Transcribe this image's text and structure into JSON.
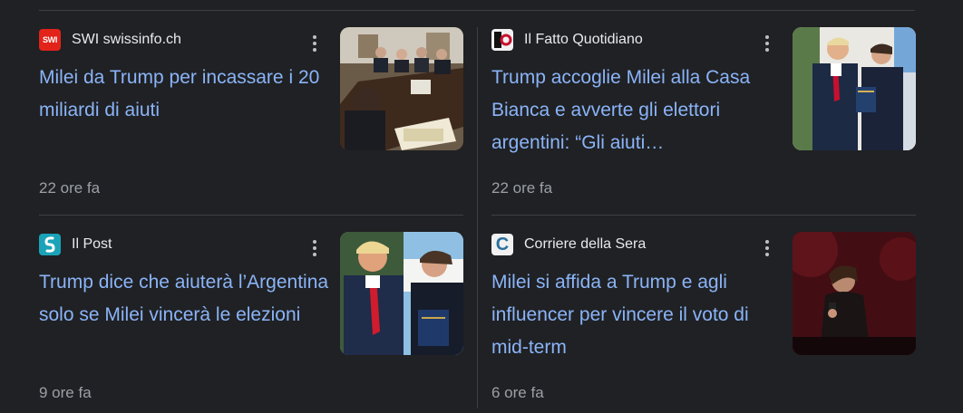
{
  "cards": [
    {
      "source": "SWI swissinfo.ch",
      "favicon_text": "SWI",
      "favicon_color": "#e2231a",
      "headline": "Milei da Trump per incassare i 20 miliardi di aiuti",
      "time": "22 ore fa"
    },
    {
      "source": "Il Fatto Quotidiano",
      "favicon_color": "#f1f1f1",
      "headline": "Trump accoglie Milei alla Casa Bianca e avverte gli elettori argentini: “Gli aiuti…",
      "time": "22 ore fa"
    },
    {
      "source": "Il Post",
      "favicon_color": "#1aa3b8",
      "headline": "Trump dice che aiuterà l’Argentina solo se Milei vincerà le elezioni",
      "time": "9 ore fa"
    },
    {
      "source": "Corriere della Sera",
      "favicon_text": "C",
      "favicon_color": "#2a6f9b",
      "headline": "Milei si affida a Trump e agli influencer per vincere il voto di mid-term",
      "time": "6 ore fa"
    }
  ]
}
